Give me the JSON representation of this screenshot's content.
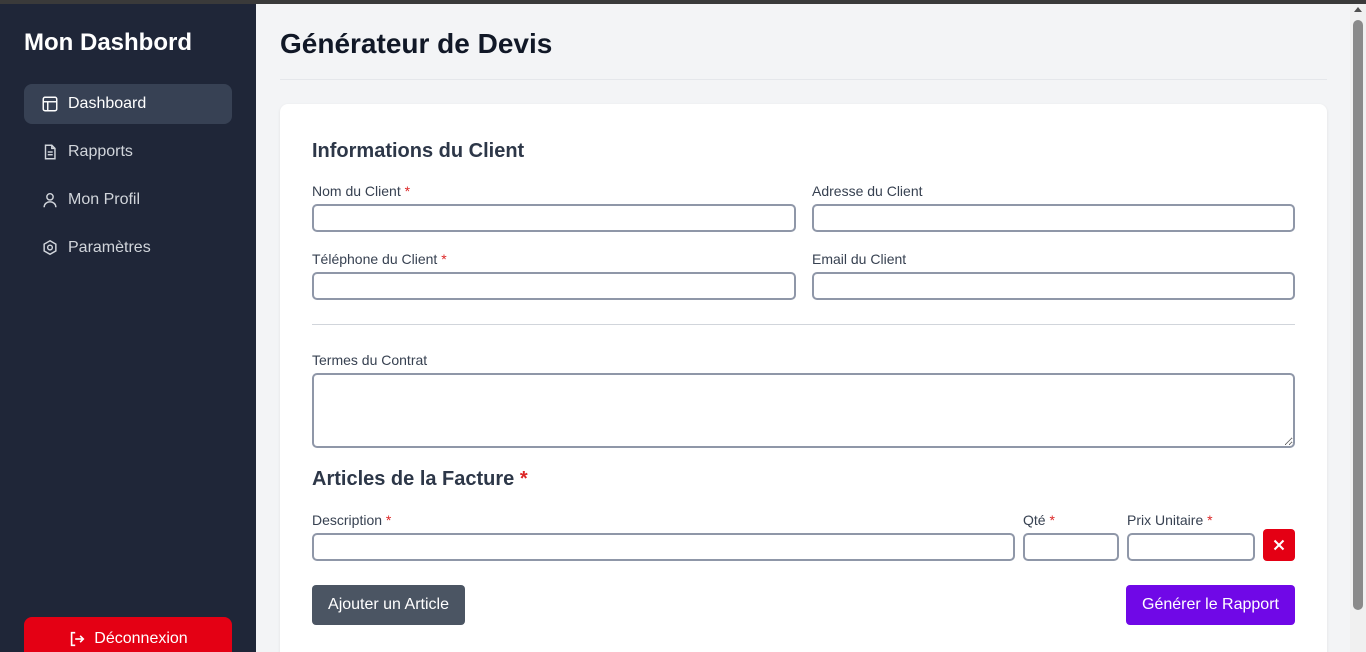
{
  "sidebar": {
    "brand": "Mon Dashbord",
    "items": [
      {
        "label": "Dashboard",
        "icon": "layout-icon",
        "active": true
      },
      {
        "label": "Rapports",
        "icon": "document-icon",
        "active": false
      },
      {
        "label": "Mon Profil",
        "icon": "user-icon",
        "active": false
      },
      {
        "label": "Paramètres",
        "icon": "settings-icon",
        "active": false
      }
    ],
    "logout_label": "Déconnexion"
  },
  "main": {
    "title": "Générateur de Devis",
    "client_section": {
      "title": "Informations du Client",
      "name_label": "Nom du Client",
      "address_label": "Adresse du Client",
      "phone_label": "Téléphone du Client",
      "email_label": "Email du Client",
      "name_value": "",
      "address_value": "",
      "phone_value": "",
      "email_value": ""
    },
    "contract": {
      "label": "Termes du Contrat",
      "value": ""
    },
    "items_section": {
      "title": "Articles de la Facture",
      "description_label": "Description",
      "qty_label": "Qté",
      "price_label": "Prix Unitaire",
      "description_value": "",
      "qty_value": "",
      "price_value": ""
    },
    "add_button": "Ajouter un Article",
    "generate_button": "Générer le Rapport",
    "required_marker": "*"
  },
  "colors": {
    "sidebar_bg": "#1f2638",
    "active_item_bg": "#374154",
    "logout_bg": "#e40014",
    "primary": "#7008e7",
    "secondary": "#4b5563",
    "danger": "#e40014"
  }
}
